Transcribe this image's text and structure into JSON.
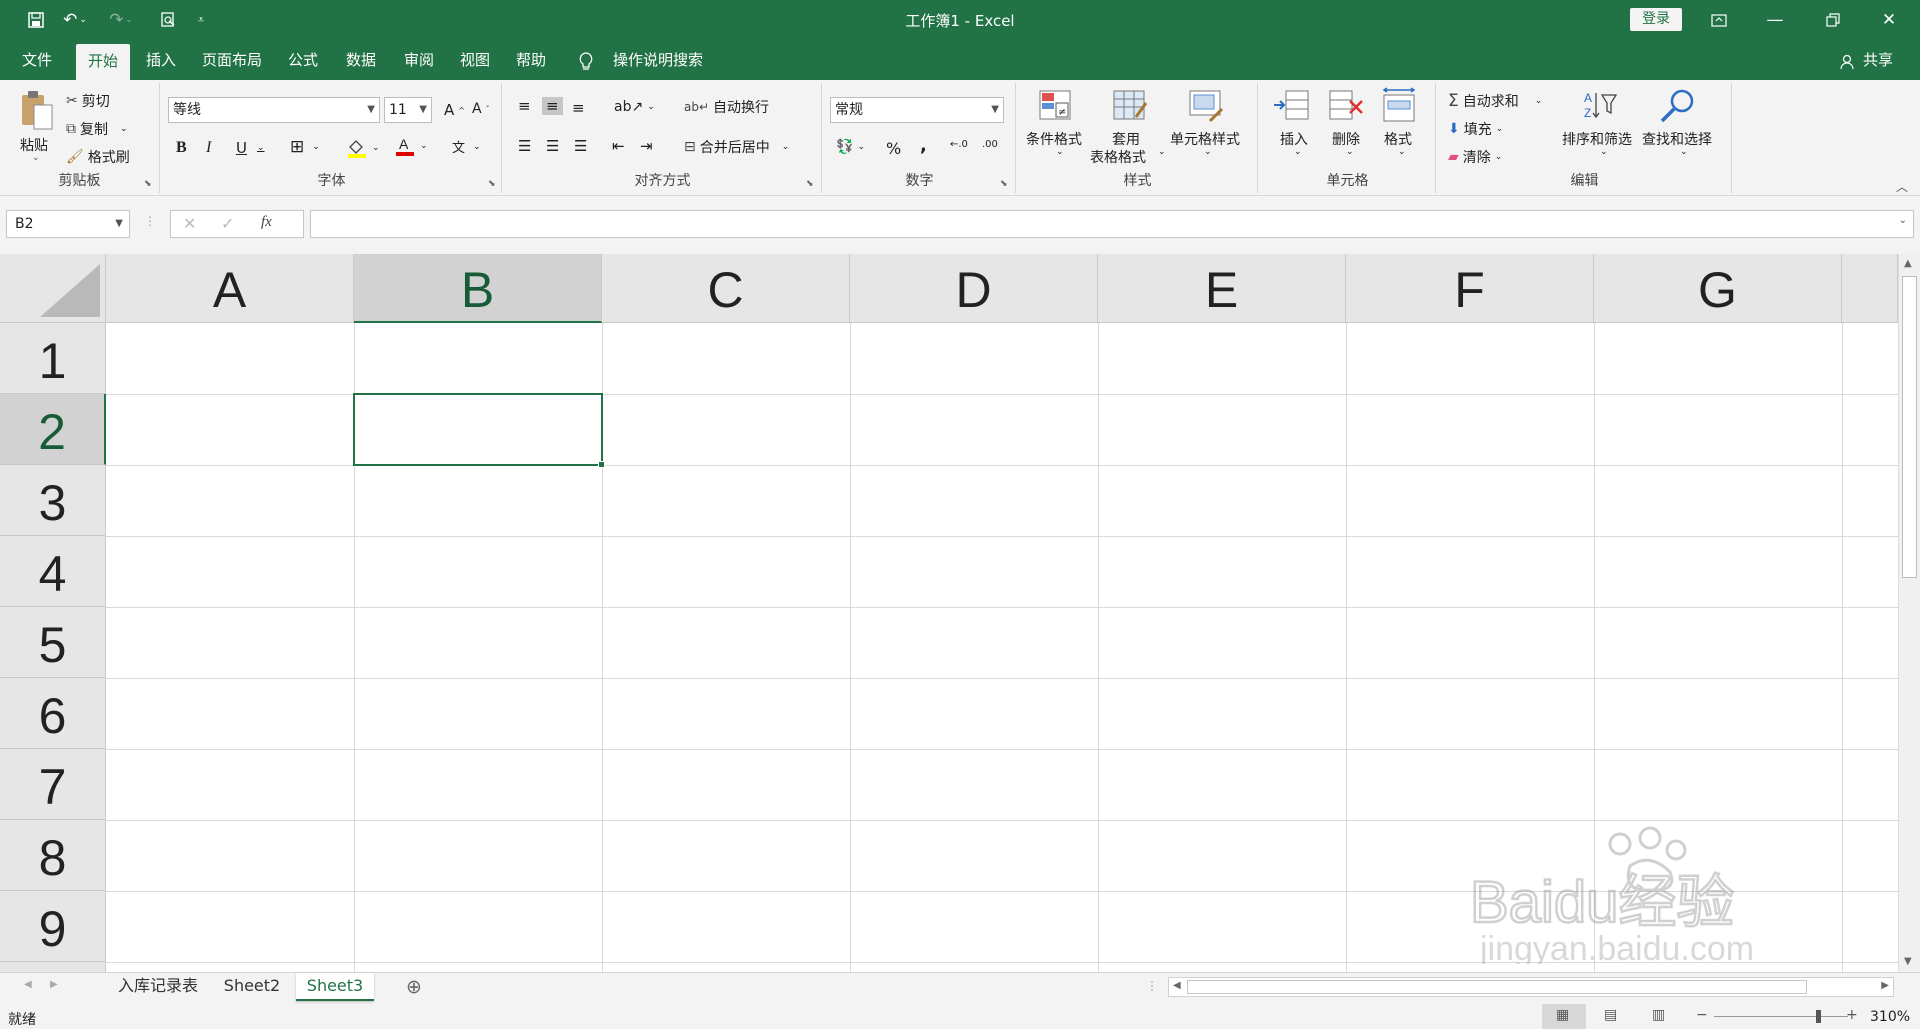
{
  "title": "工作簿1 - Excel",
  "login_label": "登录",
  "tabs": [
    "文件",
    "开始",
    "插入",
    "页面布局",
    "公式",
    "数据",
    "审阅",
    "视图",
    "帮助",
    "操作说明搜索"
  ],
  "active_tab": "开始",
  "share_label": "共享",
  "clipboard": {
    "paste": "粘贴",
    "cut": "剪切",
    "copy": "复制",
    "format_painter": "格式刷",
    "group": "剪贴板"
  },
  "font": {
    "name": "等线",
    "size": "11",
    "group": "字体"
  },
  "alignment": {
    "wrap": "自动换行",
    "merge": "合并后居中",
    "group": "对齐方式"
  },
  "number": {
    "format": "常规",
    "percent": "%",
    "comma": ",",
    "group": "数字"
  },
  "styles": {
    "conditional": "条件格式",
    "table_1": "套用",
    "table_2": "表格格式",
    "cell_styles": "单元格样式",
    "group": "样式"
  },
  "cells": {
    "insert": "插入",
    "delete": "删除",
    "format": "格式",
    "group": "单元格"
  },
  "editing": {
    "autosum": "自动求和",
    "fill": "填充",
    "clear": "清除",
    "sort": "排序和筛选",
    "find": "查找和选择",
    "group": "编辑"
  },
  "name_box": "B2",
  "formula_value": "",
  "fx_label": "fx",
  "columns": [
    "A",
    "B",
    "C",
    "D",
    "E",
    "F",
    "G"
  ],
  "rows": [
    "1",
    "2",
    "3",
    "4",
    "5",
    "6",
    "7",
    "8",
    "9"
  ],
  "selected_cell": "B2",
  "sheets": [
    "入库记录表",
    "Sheet2",
    "Sheet3"
  ],
  "active_sheet": "Sheet3",
  "status": "就绪",
  "zoom": "310%",
  "watermark": {
    "brand": "Baidu经验",
    "url": "jingyan.baidu.com"
  },
  "colors": {
    "accent": "#217346",
    "selected_text": "#185c37"
  }
}
